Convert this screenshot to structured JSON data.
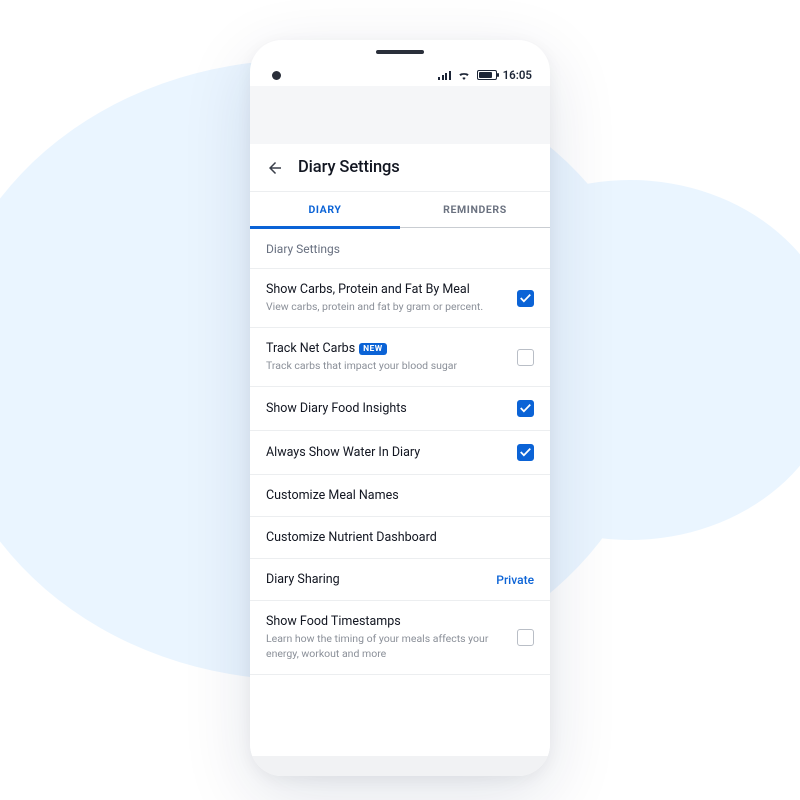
{
  "statusbar": {
    "time": "16:05"
  },
  "header": {
    "title": "Diary Settings"
  },
  "tabs": [
    {
      "label": "DIARY",
      "active": true
    },
    {
      "label": "REMINDERS",
      "active": false
    }
  ],
  "section_label": "Diary Settings",
  "rows": [
    {
      "title": "Show Carbs, Protein and Fat By Meal",
      "sub": "View carbs, protein and fat by gram or percent.",
      "type": "check",
      "checked": true
    },
    {
      "title": "Track Net Carbs",
      "badge": "NEW",
      "sub": "Track carbs that impact your blood sugar",
      "type": "check",
      "checked": false
    },
    {
      "title": "Show Diary Food Insights",
      "type": "check",
      "checked": true
    },
    {
      "title": "Always Show Water In Diary",
      "type": "check",
      "checked": true
    },
    {
      "title": "Customize Meal Names",
      "type": "nav"
    },
    {
      "title": "Customize Nutrient Dashboard",
      "type": "nav"
    },
    {
      "title": "Diary Sharing",
      "type": "value",
      "value": "Private"
    },
    {
      "title": "Show Food Timestamps",
      "sub": "Learn how the timing of your meals affects your energy, workout and more",
      "type": "check",
      "checked": false
    }
  ]
}
